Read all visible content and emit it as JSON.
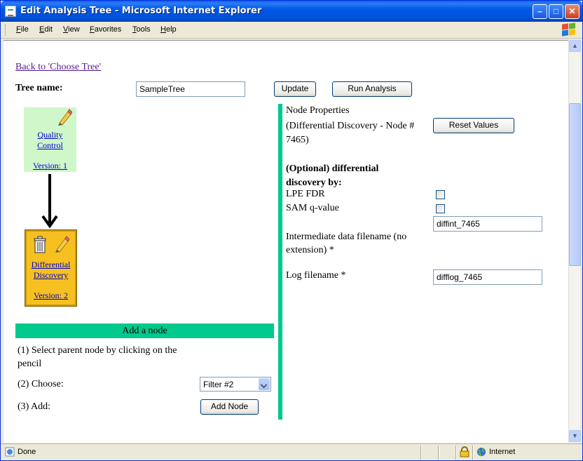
{
  "window": {
    "title": "Edit Analysis Tree - Microsoft Internet Explorer"
  },
  "menu": [
    "File",
    "Edit",
    "View",
    "Favorites",
    "Tools",
    "Help"
  ],
  "page": {
    "back_link": "Back to 'Choose Tree'",
    "tree_name_label": "Tree name:",
    "tree_name_value": "SampleTree",
    "update_button": "Update",
    "run_button": "Run Analysis"
  },
  "nodes": [
    {
      "name_line1": "Quality",
      "name_line2": "Control",
      "version": "Version: 1",
      "icons": [
        "pencil-icon"
      ],
      "color": "#cff7c9"
    },
    {
      "name_line1": "Differential",
      "name_line2": "Discovery",
      "version": "Version: 2",
      "icons": [
        "trash-icon",
        "pencil-icon"
      ],
      "color": "#f6c020"
    }
  ],
  "add_node": {
    "header": "Add a node",
    "step1": "(1) Select parent node by clicking on the pencil",
    "step2": "(2) Choose:",
    "choose_value": "Filter #2",
    "step3": "(3) Add:",
    "add_button": "Add Node"
  },
  "properties": {
    "title": "Node Properties",
    "subtitle": "(Differential Discovery - Node # 7465)",
    "reset_button": "Reset Values",
    "optional_heading": "(Optional) differential discovery by:",
    "lpe_label": "LPE FDR",
    "lpe_checked": false,
    "sam_label": "SAM q-value",
    "sam_checked": false,
    "intermediate_label": "Intermediate data filename (no extension) *",
    "intermediate_value": "diffint_7465",
    "log_label": "Log filename *",
    "log_value": "difflog_7465"
  },
  "status": {
    "text": "Done",
    "zone": "Internet"
  },
  "colors": {
    "accent_bar": "#00c98d",
    "selected_node": "#f6c020",
    "root_node": "#cff7c9"
  }
}
